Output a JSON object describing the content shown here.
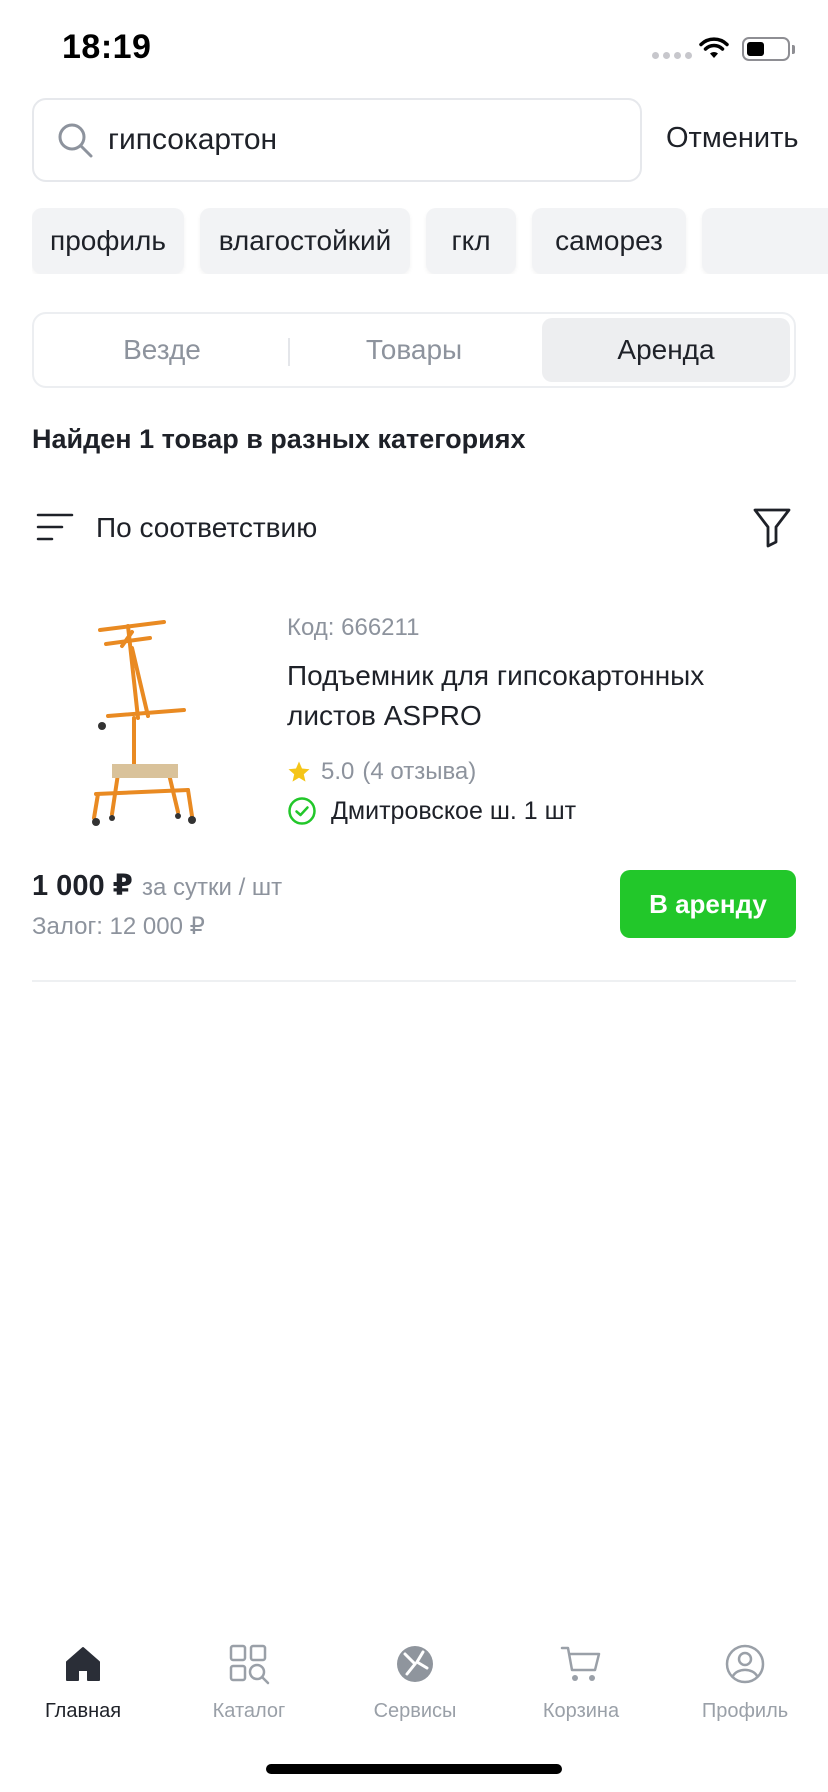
{
  "status_bar": {
    "time": "18:19"
  },
  "search": {
    "value": "гипсокартон",
    "cancel_label": "Отменить"
  },
  "chips": [
    "профиль",
    "влагостойкий",
    "гкл",
    "саморез"
  ],
  "segments": {
    "all": "Везде",
    "goods": "Товары",
    "rent": "Аренда",
    "selected": "Аренда"
  },
  "results_title": "Найден 1 товар в разных категориях",
  "sort_label": "По соответствию",
  "product": {
    "code": "Код: 666211",
    "title": "Подъемник для гипсокартонных листов ASPRO",
    "rating": "5.0",
    "reviews": "(4 отзыва)",
    "availability": "Дмитровское ш. 1 шт",
    "price": "1 000 ₽",
    "price_unit": "за сутки / шт",
    "deposit": "Залог: 12 000 ₽",
    "rent_button": "В аренду"
  },
  "nav": {
    "home": "Главная",
    "catalog": "Каталог",
    "services": "Сервисы",
    "cart": "Корзина",
    "profile": "Профиль",
    "active": "home"
  },
  "colors": {
    "accent_green": "#22c72a",
    "star": "#f5c518",
    "text": "#1e2128",
    "muted": "#8d939d"
  },
  "battery_level": 0.45
}
